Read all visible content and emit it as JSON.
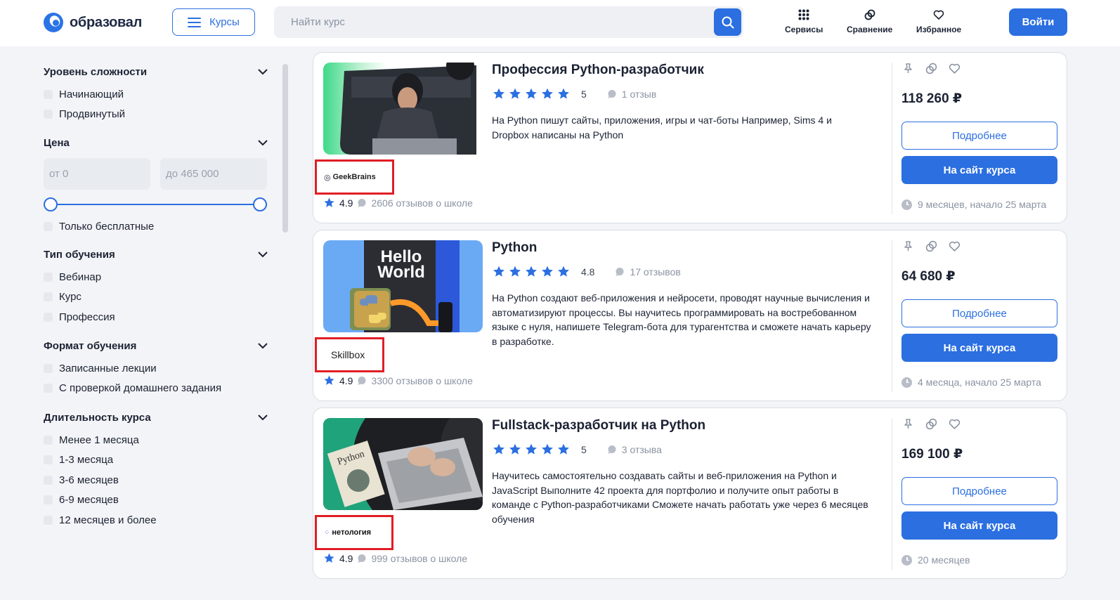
{
  "header": {
    "logo_text": "образовал",
    "courses_button": "Курсы",
    "search_placeholder": "Найти курс",
    "nav": [
      {
        "label": "Сервисы",
        "icon": "grid-icon"
      },
      {
        "label": "Сравнение",
        "icon": "compare-icon"
      },
      {
        "label": "Избранное",
        "icon": "heart-icon"
      }
    ],
    "login_button": "Войти"
  },
  "sidebar": {
    "difficulty": {
      "title": "Уровень сложности",
      "options": [
        "Начинающий",
        "Продвинутый"
      ]
    },
    "price": {
      "title": "Цена",
      "from_placeholder": "от 0",
      "to_placeholder": "до 465 000",
      "free_only": "Только бесплатные",
      "range_min": 0,
      "range_max": 465000
    },
    "type": {
      "title": "Тип обучения",
      "options": [
        "Вебинар",
        "Курс",
        "Профессия"
      ]
    },
    "format": {
      "title": "Формат обучения",
      "options": [
        "Записанные лекции",
        "С проверкой домашнего задания"
      ]
    },
    "duration": {
      "title": "Длительность курса",
      "options": [
        "Менее 1 месяца",
        "1-3 месяца",
        "3-6 месяцев",
        "6-9 месяцев",
        "12 месяцев и более"
      ]
    }
  },
  "courses": [
    {
      "title": "Профессия Python-разработчик",
      "rating": "5",
      "reviews": "1 отзыв",
      "description": "На Python пишут сайты, приложения, игры и чат-боты Например, Sims 4 и Dropbox написаны на Python",
      "school": "GeekBrains",
      "school_rating": "4.9",
      "school_reviews": "2606 отзывов о школе",
      "price": "118 260 ₽",
      "more_button": "Подробнее",
      "site_button": "На сайт курса",
      "duration": "9 месяцев, начало 25 марта"
    },
    {
      "title": "Python",
      "rating": "4.8",
      "reviews": "17 отзывов",
      "description": "На Python создают веб-приложения и нейросети, проводят научные вычисления и автоматизируют процессы. Вы научитесь программировать на востребованном языке с нуля, напишете Telegram-бота для турагентства и сможете начать карьеру в разработке.",
      "thumb_text_1": "Hello",
      "thumb_text_2": "World",
      "school": "Skillbox",
      "school_rating": "4.9",
      "school_reviews": "3300 отзывов о школе",
      "price": "64 680 ₽",
      "more_button": "Подробнее",
      "site_button": "На сайт курса",
      "duration": "4 месяца, начало 25 марта"
    },
    {
      "title": "Fullstack-разработчик на Python",
      "rating": "5",
      "reviews": "3 отзыва",
      "description": "Научитесь самостоятельно создавать сайты и веб-приложения на Python и JavaScript Выполните 42 проекта для портфолио и получите опыт работы в команде с Python-разработчиками Сможете начать работать уже через 6 месяцев обучения",
      "thumb_text_1": "Python",
      "school": "нетология",
      "school_rating": "4.9",
      "school_reviews": "999 отзывов о школе",
      "price": "169 100 ₽",
      "more_button": "Подробнее",
      "site_button": "На сайт курса",
      "duration": "20 месяцев"
    }
  ],
  "colors": {
    "accent": "#2b6fe0",
    "highlight": "#e01e25",
    "star": "#2b6fe0"
  }
}
